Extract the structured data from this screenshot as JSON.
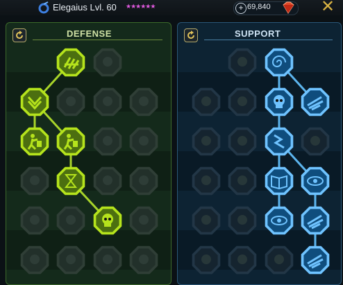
{
  "header": {
    "champion_name": "Elegaius Lvl. 60",
    "stars": "★★★★★★",
    "currency_plus": "+",
    "currency_value": "69,840",
    "close_label": "✕",
    "icons": {
      "champion": "affinity-swirl-icon",
      "gem": "gem-icon"
    }
  },
  "panels": {
    "defense": {
      "title": "DEFENSE",
      "reset_icon": "reset-icon"
    },
    "support": {
      "title": "SUPPORT",
      "reset_icon": "reset-icon"
    }
  },
  "skill_tree": {
    "defense": {
      "nodes": [
        {
          "name": "def-r1-c2",
          "row": 1,
          "col": 2,
          "state": "active",
          "icon": "shield-bricks-icon"
        },
        {
          "name": "def-r1-c3",
          "row": 1,
          "col": 3,
          "state": "locked",
          "icon": "locked-icon"
        },
        {
          "name": "def-r2-c1",
          "row": 2,
          "col": 1,
          "state": "active",
          "icon": "armor-chevron-icon"
        },
        {
          "name": "def-r2-c2",
          "row": 2,
          "col": 2,
          "state": "locked",
          "icon": "locked-icon"
        },
        {
          "name": "def-r2-c3",
          "row": 2,
          "col": 3,
          "state": "locked",
          "icon": "locked-icon"
        },
        {
          "name": "def-r2-c4",
          "row": 2,
          "col": 4,
          "state": "locked",
          "icon": "locked-icon"
        },
        {
          "name": "def-r3-c1",
          "row": 3,
          "col": 1,
          "state": "active",
          "icon": "running-figures-icon"
        },
        {
          "name": "def-r3-c2",
          "row": 3,
          "col": 2,
          "state": "active",
          "icon": "knight-shield-icon"
        },
        {
          "name": "def-r3-c3",
          "row": 3,
          "col": 3,
          "state": "locked",
          "icon": "locked-icon"
        },
        {
          "name": "def-r3-c4",
          "row": 3,
          "col": 4,
          "state": "locked",
          "icon": "locked-icon"
        },
        {
          "name": "def-r4-c1",
          "row": 4,
          "col": 1,
          "state": "locked",
          "icon": "locked-icon"
        },
        {
          "name": "def-r4-c2",
          "row": 4,
          "col": 2,
          "state": "active",
          "icon": "hourglass-icon"
        },
        {
          "name": "def-r4-c3",
          "row": 4,
          "col": 3,
          "state": "locked",
          "icon": "locked-icon"
        },
        {
          "name": "def-r4-c4",
          "row": 4,
          "col": 4,
          "state": "locked",
          "icon": "locked-icon"
        },
        {
          "name": "def-r5-c1",
          "row": 5,
          "col": 1,
          "state": "locked",
          "icon": "locked-icon"
        },
        {
          "name": "def-r5-c2",
          "row": 5,
          "col": 2,
          "state": "locked",
          "icon": "locked-icon"
        },
        {
          "name": "def-r5-c3",
          "row": 5,
          "col": 3,
          "state": "active",
          "icon": "skull-icon"
        },
        {
          "name": "def-r5-c4",
          "row": 5,
          "col": 4,
          "state": "locked",
          "icon": "locked-icon"
        },
        {
          "name": "def-r6-c1",
          "row": 6,
          "col": 1,
          "state": "locked",
          "icon": "locked-icon"
        },
        {
          "name": "def-r6-c2",
          "row": 6,
          "col": 2,
          "state": "locked",
          "icon": "locked-icon"
        },
        {
          "name": "def-r6-c3",
          "row": 6,
          "col": 3,
          "state": "locked",
          "icon": "locked-icon"
        },
        {
          "name": "def-r6-c4",
          "row": 6,
          "col": 4,
          "state": "locked",
          "icon": "locked-icon"
        }
      ],
      "links": [
        [
          "def-r1-c2",
          "def-r2-c1"
        ],
        [
          "def-r2-c1",
          "def-r3-c2"
        ],
        [
          "def-r2-c1",
          "def-r3-c1"
        ],
        [
          "def-r3-c2",
          "def-r4-c2"
        ],
        [
          "def-r4-c2",
          "def-r5-c3"
        ]
      ],
      "colors": {
        "active": "#b5e31c",
        "active_dark": "#4c6f10",
        "locked": "#22302a",
        "locked_border": "#2f3e36",
        "link": "#a8d42a"
      }
    },
    "support": {
      "nodes": [
        {
          "name": "sup-r1-c2",
          "row": 1,
          "col": 2,
          "state": "locked",
          "icon": "locked-icon"
        },
        {
          "name": "sup-r1-c3",
          "row": 1,
          "col": 3,
          "state": "active",
          "icon": "spiral-icon"
        },
        {
          "name": "sup-r2-c1",
          "row": 2,
          "col": 1,
          "state": "locked",
          "icon": "locked-icon"
        },
        {
          "name": "sup-r2-c2",
          "row": 2,
          "col": 2,
          "state": "locked",
          "icon": "locked-icon"
        },
        {
          "name": "sup-r2-c3",
          "row": 2,
          "col": 3,
          "state": "active",
          "icon": "flaming-skull-icon"
        },
        {
          "name": "sup-r2-c4",
          "row": 2,
          "col": 4,
          "state": "active",
          "icon": "wind-arrows-icon"
        },
        {
          "name": "sup-r3-c1",
          "row": 3,
          "col": 1,
          "state": "locked",
          "icon": "locked-icon"
        },
        {
          "name": "sup-r3-c2",
          "row": 3,
          "col": 2,
          "state": "locked",
          "icon": "locked-icon"
        },
        {
          "name": "sup-r3-c3",
          "row": 3,
          "col": 3,
          "state": "active",
          "icon": "lightning-icon"
        },
        {
          "name": "sup-r3-c4",
          "row": 3,
          "col": 4,
          "state": "locked",
          "icon": "locked-icon"
        },
        {
          "name": "sup-r4-c1",
          "row": 4,
          "col": 1,
          "state": "locked",
          "icon": "locked-icon"
        },
        {
          "name": "sup-r4-c2",
          "row": 4,
          "col": 2,
          "state": "locked",
          "icon": "locked-icon"
        },
        {
          "name": "sup-r4-c3",
          "row": 4,
          "col": 3,
          "state": "active",
          "icon": "book-icon"
        },
        {
          "name": "sup-r4-c4",
          "row": 4,
          "col": 4,
          "state": "active",
          "icon": "fierce-eyes-icon"
        },
        {
          "name": "sup-r5-c1",
          "row": 5,
          "col": 1,
          "state": "locked",
          "icon": "locked-icon"
        },
        {
          "name": "sup-r5-c2",
          "row": 5,
          "col": 2,
          "state": "locked",
          "icon": "locked-icon"
        },
        {
          "name": "sup-r5-c3",
          "row": 5,
          "col": 3,
          "state": "active",
          "icon": "eye-icon"
        },
        {
          "name": "sup-r5-c4",
          "row": 5,
          "col": 4,
          "state": "active",
          "icon": "slashing-figure-icon"
        },
        {
          "name": "sup-r6-c1",
          "row": 6,
          "col": 1,
          "state": "locked",
          "icon": "locked-icon"
        },
        {
          "name": "sup-r6-c2",
          "row": 6,
          "col": 2,
          "state": "locked",
          "icon": "locked-icon"
        },
        {
          "name": "sup-r6-c3",
          "row": 6,
          "col": 3,
          "state": "locked",
          "icon": "locked-icon"
        },
        {
          "name": "sup-r6-c4",
          "row": 6,
          "col": 4,
          "state": "active",
          "icon": "eagle-icon"
        }
      ],
      "links": [
        [
          "sup-r1-c3",
          "sup-r2-c3"
        ],
        [
          "sup-r1-c3",
          "sup-r2-c4"
        ],
        [
          "sup-r2-c3",
          "sup-r3-c3"
        ],
        [
          "sup-r3-c3",
          "sup-r4-c3"
        ],
        [
          "sup-r3-c3",
          "sup-r4-c4"
        ],
        [
          "sup-r4-c3",
          "sup-r5-c3"
        ],
        [
          "sup-r4-c4",
          "sup-r5-c4"
        ],
        [
          "sup-r5-c4",
          "sup-r6-c4"
        ]
      ],
      "colors": {
        "active": "#6fc3ff",
        "active_dark": "#0f4d7d",
        "locked": "#15242f",
        "locked_border": "#223646",
        "link": "#5cb5ee"
      }
    }
  }
}
